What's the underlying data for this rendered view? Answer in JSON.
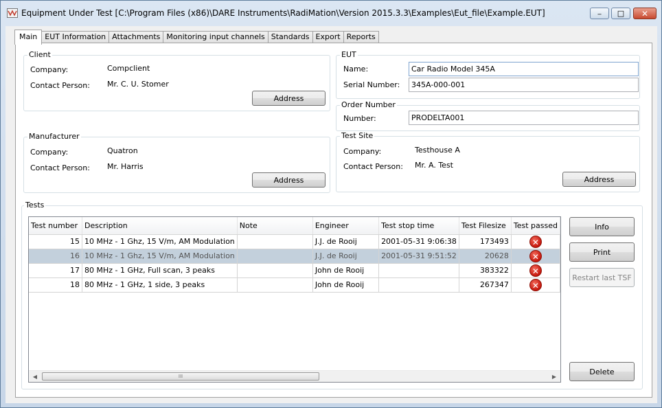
{
  "window": {
    "title": "Equipment Under Test [C:\\Program Files (x86)\\DARE Instruments\\RadiMation\\Version 2015.3.3\\Examples\\Eut_file\\Example.EUT]",
    "minimize_glyph": "_",
    "maximize_glyph": "□",
    "close_glyph": "✕"
  },
  "tabs": [
    "Main",
    "EUT Information",
    "Attachments",
    "Monitoring input channels",
    "Standards",
    "Export",
    "Reports"
  ],
  "client": {
    "title": "Client",
    "company_label": "Company:",
    "company": "Compclient",
    "contact_label": "Contact Person:",
    "contact": "Mr. C. U. Stomer",
    "address_button": "Address"
  },
  "manufacturer": {
    "title": "Manufacturer",
    "company_label": "Company:",
    "company": "Quatron",
    "contact_label": "Contact Person:",
    "contact": "Mr. Harris",
    "address_button": "Address"
  },
  "eut": {
    "title": "EUT",
    "name_label": "Name:",
    "name": "Car Radio Model 345A",
    "serial_label": "Serial Number:",
    "serial": "345A-000-001"
  },
  "order": {
    "title": "Order Number",
    "number_label": "Number:",
    "number": "PRODELTA001"
  },
  "test_site": {
    "title": "Test Site",
    "company_label": "Company:",
    "company": "Testhouse A",
    "contact_label": "Contact Person:",
    "contact": "Mr. A. Test",
    "address_button": "Address"
  },
  "tests": {
    "title": "Tests",
    "columns": [
      "Test number",
      "Description",
      "Note",
      "Engineer",
      "Test stop time",
      "Test Filesize",
      "Test passed"
    ],
    "rows": [
      {
        "number": "15",
        "description": "10 MHz - 1 Ghz, 15 V/m, AM Modulation",
        "note": "",
        "engineer": "J.J. de Rooij",
        "stop_time": "2001-05-31 9:06:38",
        "filesize": "173493",
        "passed": false
      },
      {
        "number": "16",
        "description": "10 MHz - 1 Ghz, 15 V/m, AM Modulation",
        "note": "",
        "engineer": "J.J. de Rooij",
        "stop_time": "2001-05-31 9:51:52",
        "filesize": "20628",
        "passed": false,
        "selected": true
      },
      {
        "number": "17",
        "description": "80 MHz - 1 GHz, Full scan, 3 peaks",
        "note": "",
        "engineer": "John de Rooij",
        "stop_time": "",
        "filesize": "383322",
        "passed": false
      },
      {
        "number": "18",
        "description": "80 MHz - 1 GHz, 1 side, 3 peaks",
        "note": "",
        "engineer": "John de Rooij",
        "stop_time": "",
        "filesize": "267347",
        "passed": false
      }
    ],
    "buttons": {
      "info": "Info",
      "print": "Print",
      "restart": "Restart last TSF",
      "delete": "Delete"
    },
    "fail_glyph": "✕",
    "scroll_left_glyph": "◀",
    "scroll_right_glyph": "▶",
    "scroll_thumb_glyph": "III"
  }
}
